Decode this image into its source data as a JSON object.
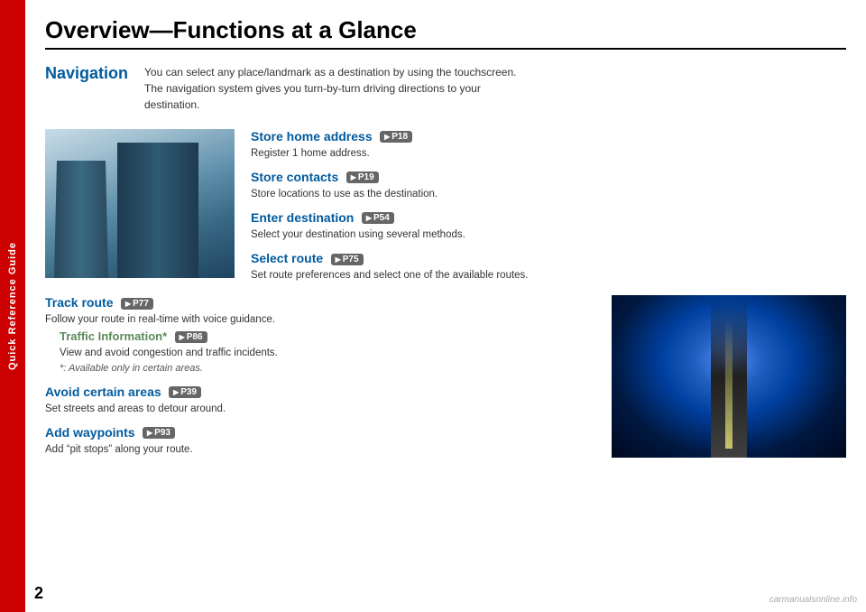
{
  "sidebar": {
    "label": "Quick Reference Guide"
  },
  "page": {
    "title": "Overview—Functions at a Glance",
    "number": "2"
  },
  "navigation_section": {
    "label": "Navigation",
    "description": "You can select any place/landmark as a destination by using the touchscreen. The navigation system gives you turn-by-turn driving directions to your destination.",
    "items": [
      {
        "id": "store-home",
        "title": "Store home address",
        "page_ref": "P18",
        "description": "Register 1 home address."
      },
      {
        "id": "store-contacts",
        "title": "Store contacts",
        "page_ref": "P19",
        "description": "Store locations to use as the destination."
      },
      {
        "id": "enter-destination",
        "title": "Enter destination",
        "page_ref": "P54",
        "description": "Select your destination using several methods."
      },
      {
        "id": "select-route",
        "title": "Select route",
        "page_ref": "P75",
        "description": "Set route preferences and select one of the available routes."
      }
    ]
  },
  "bottom_section": {
    "items": [
      {
        "id": "track-route",
        "title": "Track route",
        "page_ref": "P77",
        "description": "Follow your route in real-time with voice guidance.",
        "sub_item": {
          "title": "Traffic Information*",
          "page_ref": "P86",
          "description": "View and avoid congestion and traffic incidents.",
          "note": "*: Available only in certain areas."
        }
      },
      {
        "id": "avoid-areas",
        "title": "Avoid certain areas",
        "page_ref": "P39",
        "description": "Set streets and areas to detour around."
      },
      {
        "id": "add-waypoints",
        "title": "Add waypoints",
        "page_ref": "P93",
        "description": "Add “pit stops” along your route."
      }
    ]
  },
  "watermark": {
    "text": "carmanualsonline.info"
  }
}
